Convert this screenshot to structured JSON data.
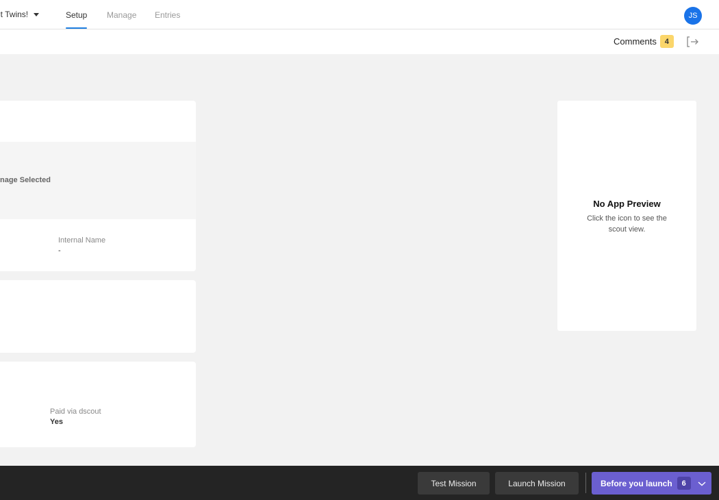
{
  "nav": {
    "mission_name": "nt Twins!",
    "tabs": [
      {
        "label": "Setup",
        "active": true
      },
      {
        "label": "Manage",
        "active": false
      },
      {
        "label": "Entries",
        "active": false
      }
    ],
    "avatar_initials": "JS"
  },
  "subbar": {
    "comments_label": "Comments",
    "comments_count": "4"
  },
  "card1": {
    "no_image_text": "nage Selected",
    "internal_name_label": "Internal Name",
    "internal_name_value": "-"
  },
  "card3": {
    "paid_label": "Paid via dscout",
    "paid_value": "Yes"
  },
  "preview": {
    "title": "No App Preview",
    "subtitle": "Click the icon to see the scout view."
  },
  "bottombar": {
    "test_label": "Test Mission",
    "launch_label": "Launch Mission",
    "before_label": "Before you launch",
    "before_count": "6"
  },
  "colors": {
    "accent": "#1e7fe0",
    "launch_purple": "#6b5fd0",
    "badge_yellow": "#fbd66b",
    "bottom_bar": "#242424"
  }
}
